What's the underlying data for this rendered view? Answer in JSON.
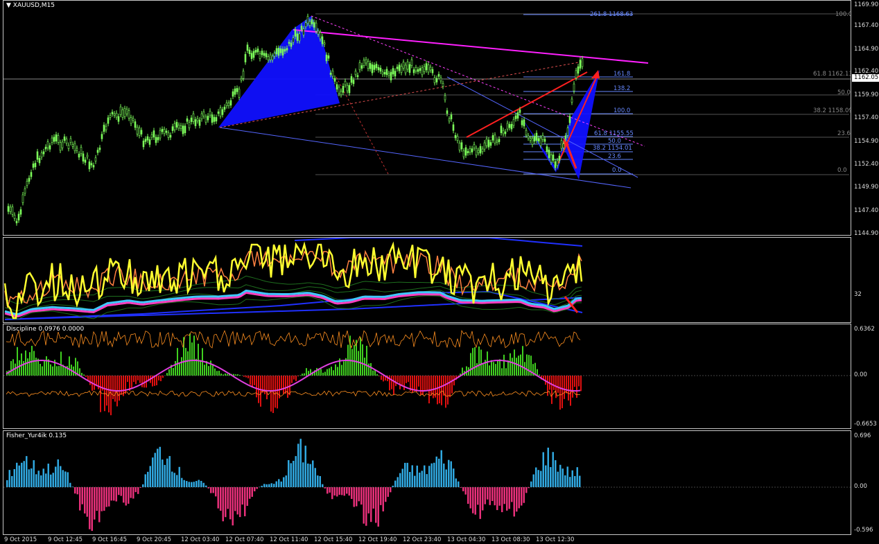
{
  "symbol": "XAUUSD,M15",
  "current_price": "1162.05",
  "main_scale": [
    "1169.90",
    "1167.40",
    "1164.90",
    "1162.40",
    "1159.90",
    "1157.40",
    "1154.90",
    "1152.40",
    "1149.90",
    "1147.40",
    "1144.90"
  ],
  "fib_labels": {
    "ext_2618": "261.8 1168.63",
    "top_100": "100.0",
    "ret_618_price": "61.8 1162.13",
    "ext_1618": "161.8",
    "ret_500_right": "50.0",
    "ext_1382": "138.2",
    "ret_382_price": "38.2 1158.09",
    "ext_100": "100.0",
    "ret_236_right": "23.6",
    "ret_618_low": "61.8 1155.55",
    "ret_500_low": "50.0",
    "ret_382_low": "38.2 1154.01",
    "ret_236_low": "23.6",
    "ret_0_low": "0.0",
    "ret_0_right": "0.0"
  },
  "osc_scale": [
    "32"
  ],
  "discipline": {
    "title": "Discipline 0.0976 0.0000",
    "scale": [
      "0.6362",
      "0.00",
      "-0.6653"
    ]
  },
  "fisher": {
    "title": "Fisher_Yur4ik 0.135",
    "scale": [
      "0.696",
      "0.00",
      "-0.596"
    ]
  },
  "time_labels": [
    "9 Oct 2015",
    "9 Oct 12:45",
    "9 Oct 16:45",
    "9 Oct 20:45",
    "12 Oct 03:40",
    "12 Oct 07:40",
    "12 Oct 11:40",
    "12 Oct 15:40",
    "12 Oct 19:40",
    "12 Oct 23:40",
    "13 Oct 04:30",
    "13 Oct 08:30",
    "13 Oct 12:30"
  ],
  "colors": {
    "candles": "#7cfc5a",
    "harmonic_fill": "#1010ff",
    "trend_magenta": "#ff20ff",
    "red_lines": "#ff2020",
    "yellow": "#ffff30",
    "fisher_pos": "#30a8e0",
    "fisher_neg": "#e8307a",
    "disc_pos": "#40d020",
    "disc_neg": "#e01010"
  }
}
